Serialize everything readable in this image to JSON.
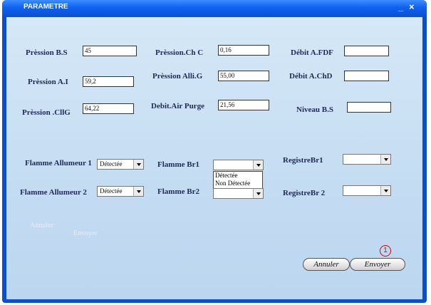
{
  "window": {
    "title": "PARAMETRE",
    "minimize_glyph": "_",
    "close_glyph": "×"
  },
  "fields": {
    "pression_bs": {
      "label": "Prèssion B.S",
      "value": "45"
    },
    "pression_ai": {
      "label": "Prèssion A.I",
      "value": "59,2"
    },
    "pression_cllg": {
      "label": "Prèssion .CllG",
      "value": "64,22"
    },
    "pression_chc": {
      "label": "Prèssion.Ch C",
      "value": "0,16"
    },
    "pression_allig": {
      "label": "Prèssion Alli.G",
      "value": "55,00"
    },
    "debit_air_purge": {
      "label": "Debit.Air Purge",
      "value": "21,56"
    },
    "debit_afdf": {
      "label": "Débit A.FDF",
      "value": ""
    },
    "debit_achd": {
      "label": "Débit A.ChD",
      "value": ""
    },
    "niveau_bs": {
      "label": "Niveau B.S",
      "value": ""
    }
  },
  "dropdowns": {
    "flamme_allumeur_1": {
      "label": "Flamme Allumeur 1",
      "selected": "Détectée"
    },
    "flamme_allumeur_2": {
      "label": "Flamme Allumeur 2",
      "selected": "Détectée"
    },
    "flamme_br1": {
      "label": "Flamme Br1",
      "selected": ""
    },
    "flamme_br2": {
      "label": "Flamme Br2",
      "selected": ""
    },
    "registre_br1": {
      "label": "RegistreBr1",
      "selected": ""
    },
    "registre_br2": {
      "label": "RegistreBr 2",
      "selected": ""
    }
  },
  "open_list": {
    "options": [
      "Détectée",
      "Non Détectée"
    ]
  },
  "ghost": {
    "annuler": "Annuler",
    "envoyer": "Envoyer"
  },
  "buttons": {
    "annuler": "Annuler",
    "envoyer": "Envoyer"
  },
  "marker": {
    "number": "1"
  }
}
